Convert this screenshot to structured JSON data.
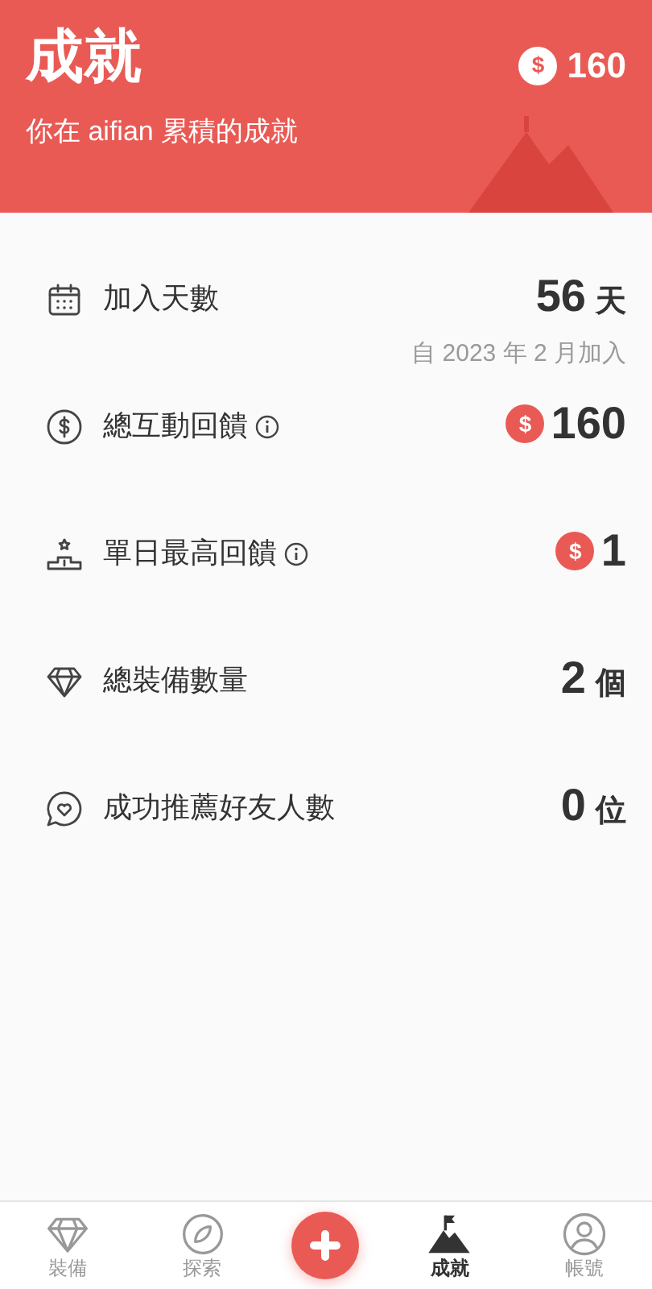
{
  "header": {
    "title": "成就",
    "subtitle": "你在 aifian 累積的成就",
    "coin_symbol": "$",
    "balance": "160"
  },
  "stats": [
    {
      "kind": "days",
      "label": "加入天數",
      "info": false,
      "value": "56",
      "unit": "天",
      "note": "自 2023 年 2 月加入"
    },
    {
      "kind": "coins",
      "label": "總互動回饋",
      "info": true,
      "coin_symbol": "$",
      "value": "160"
    },
    {
      "kind": "coins",
      "label": "單日最高回饋",
      "info": true,
      "coin_symbol": "$",
      "value": "1"
    },
    {
      "kind": "count",
      "label": "總裝備數量",
      "info": false,
      "value": "2",
      "unit": "個"
    },
    {
      "kind": "count",
      "label": "成功推薦好友人數",
      "info": false,
      "value": "0",
      "unit": "位"
    }
  ],
  "nav": [
    {
      "kind": "tab",
      "label": "裝備",
      "selected": false
    },
    {
      "kind": "tab",
      "label": "探索",
      "selected": false
    },
    {
      "kind": "add",
      "selected": false
    },
    {
      "kind": "tab",
      "label": "成就",
      "selected": true
    },
    {
      "kind": "tab",
      "label": "帳號",
      "selected": false
    }
  ]
}
